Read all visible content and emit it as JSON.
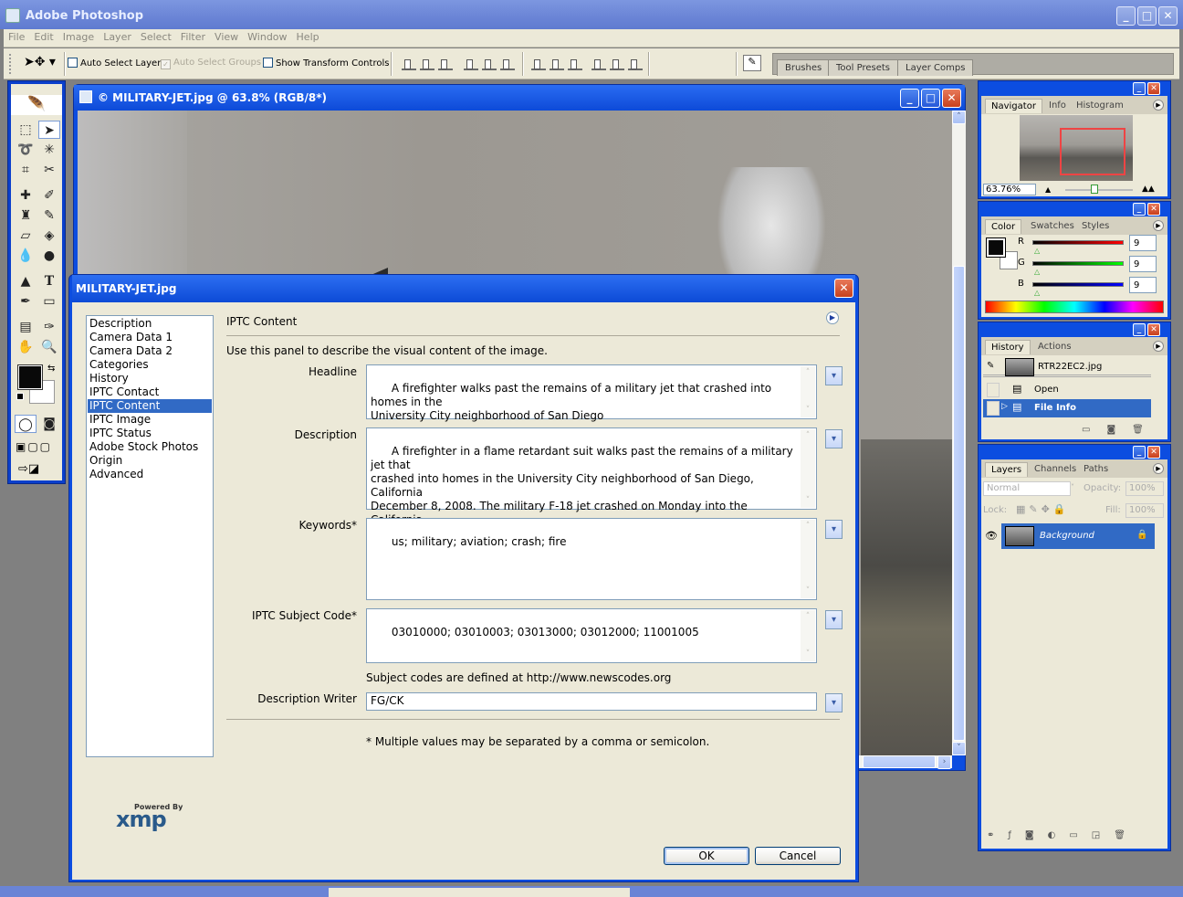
{
  "app": {
    "title": "Adobe Photoshop",
    "menu": [
      "File",
      "Edit",
      "Image",
      "Layer",
      "Select",
      "Filter",
      "View",
      "Window",
      "Help"
    ]
  },
  "options_bar": {
    "auto_select_layer": {
      "label": "Auto Select Layer",
      "checked": false
    },
    "auto_select_groups": {
      "label": "Auto Select Groups",
      "checked": true,
      "disabled": true
    },
    "show_transform_controls": {
      "label": "Show Transform Controls",
      "checked": false
    },
    "palette_well_tabs": [
      "Brushes",
      "Tool Presets",
      "Layer Comps"
    ]
  },
  "document": {
    "title": "© MILITARY-JET.jpg @ 63.8% (RGB/8*)"
  },
  "navigator": {
    "tabs": [
      "Navigator",
      "Info",
      "Histogram"
    ],
    "zoom": "63.76%"
  },
  "color": {
    "tabs": [
      "Color",
      "Swatches",
      "Styles"
    ],
    "channels": [
      {
        "name": "R",
        "value": "9"
      },
      {
        "name": "G",
        "value": "9"
      },
      {
        "name": "B",
        "value": "9"
      }
    ],
    "foreground": "#090909",
    "background": "#ffffff"
  },
  "history": {
    "tabs": [
      "History",
      "Actions"
    ],
    "snapshot": "RTR22EC2.jpg",
    "states": [
      {
        "label": "Open",
        "selected": false
      },
      {
        "label": "File Info",
        "selected": true
      }
    ]
  },
  "layers": {
    "tabs": [
      "Layers",
      "Channels",
      "Paths"
    ],
    "blend_mode": "Normal",
    "opacity_label": "Opacity:",
    "opacity": "100%",
    "lock_label": "Lock:",
    "fill_label": "Fill:",
    "fill": "100%",
    "items": [
      {
        "name": "Background",
        "visible": true,
        "locked": true
      }
    ]
  },
  "dialog": {
    "title": "MILITARY-JET.jpg",
    "categories": [
      "Description",
      "Camera Data 1",
      "Camera Data 2",
      "Categories",
      "History",
      "IPTC Contact",
      "IPTC Content",
      "IPTC Image",
      "IPTC Status",
      "Adobe Stock Photos",
      "Origin",
      "Advanced"
    ],
    "selected_category": "IPTC Content",
    "section_title": "IPTC Content",
    "instructions": "Use this panel to describe the visual content of the image.",
    "fields": {
      "headline": {
        "label": "Headline",
        "value": "A firefighter walks past the remains of a military jet that crashed into homes in the\nUniversity City neighborhood of San Diego"
      },
      "description": {
        "label": "Description",
        "value": "A firefighter in a flame retardant suit walks past the remains of a military jet that\ncrashed into homes in the University City neighborhood of San Diego, California\nDecember 8, 2008. The military F-18 jet crashed on Monday into the California\nneighborhood near San Diego after the pilot ejected, igniting at least one home,\nofficials said.  REUTERS/Fred Greaves (UNITED STATES)"
      },
      "keywords": {
        "label": "Keywords*",
        "value": "us; military; aviation; crash; fire"
      },
      "subject_code": {
        "label": "IPTC Subject Code*",
        "value": "03010000; 03010003; 03013000; 03012000; 11001005"
      },
      "description_writer": {
        "label": "Description Writer",
        "value": "FG/CK"
      }
    },
    "subject_code_note": "Subject codes are defined at http://www.newscodes.org",
    "footnote": "* Multiple values may be separated by a comma or semicolon.",
    "powered_by": "Powered By",
    "xmp_logo": "xmp",
    "ok_label": "OK",
    "cancel_label": "Cancel"
  }
}
